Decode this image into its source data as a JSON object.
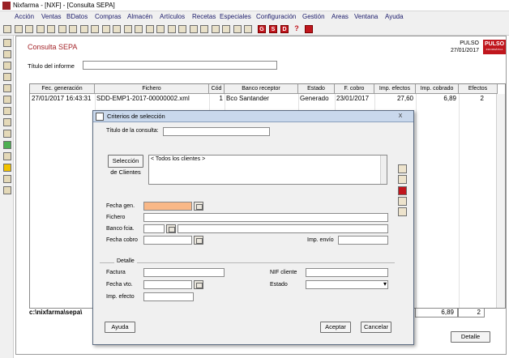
{
  "window": {
    "title": "Nixfarma - [NXF] - [Consulta SEPA]"
  },
  "menu": [
    "Acción",
    "Ventas",
    "BDatos",
    "Compras",
    "Almacén",
    "Artículos",
    "Recetas",
    "Especiales",
    "Configuración",
    "Gestión",
    "Areas",
    "Ventana",
    "Ayuda"
  ],
  "toolbar_icons": [
    "dock-icon",
    "cut-icon",
    "copy-icon",
    "paste-icon",
    "save-icon",
    "print-icon",
    "filter-icon",
    "duplicate-icon",
    "clipboard-icon",
    "calendar-icon",
    "star-icon",
    "first-icon",
    "prev-icon",
    "next-icon",
    "last-icon",
    "printer-icon",
    "find-icon",
    "binoculars-icon",
    "tools-icon",
    "exit-icon",
    "grid-icon",
    "camera-icon",
    "notes-icon"
  ],
  "toolbar_letters": {
    "g": "G",
    "s": "S",
    "d": "D",
    "help": "?"
  },
  "sidebar_icons": [
    "sales-icon",
    "cash-icon",
    "user-icon",
    "cart-icon",
    "money-icon",
    "pencil-icon",
    "box-icon",
    "document-icon",
    "calculator-icon",
    "add-icon",
    "refresh-icon",
    "warning-icon",
    "chart-icon",
    "table-icon"
  ],
  "page": {
    "title": "Consulta SEPA",
    "user": "PULSO",
    "date": "27/01/2017",
    "logo_text": "PULSO",
    "logo_sub": "INFORMÁTICA",
    "titulo_label": "Título del informe",
    "titulo_value": ""
  },
  "grid": {
    "columns": [
      "Fec. generación",
      "Fichero",
      "Cód",
      "Banco receptor",
      "Estado",
      "F. cobro",
      "Imp. efectos",
      "Imp. cobrado",
      "Efectos"
    ],
    "rows": [
      [
        "27/01/2017 16:43:31",
        "SDD-EMP1-2017-00000002.xml",
        "1",
        "Bco Santander",
        "Generado",
        "23/01/2017",
        "27,60",
        "6,89",
        "2"
      ]
    ]
  },
  "footer": {
    "path": "c:\\nixfarma\\sepa\\",
    "total_cobrado": "6,89",
    "total_efectos": "2",
    "detalle_button": "Detalle"
  },
  "dialog": {
    "title": "Criterios de selección",
    "close": "X",
    "titulo_consulta_label": "Título de la consulta:",
    "titulo_consulta_value": "",
    "sel_clientes_button": "Selección de Clientes",
    "clientes_list": [
      "< Todos los clientes >"
    ],
    "fecha_gen_label": "Fecha gen.",
    "fichero_label": "Fichero",
    "banco_label": "Banco fcia.",
    "fecha_cobro_label": "Fecha cobro",
    "imp_envio_label": "Imp. envío",
    "detalle_group": "Detalle",
    "factura_label": "Factura",
    "nif_label": "NIF cliente",
    "fecha_vto_label": "Fecha vto.",
    "estado_label": "Estado",
    "imp_efecto_label": "Imp. efecto",
    "ayuda_button": "Ayuda",
    "aceptar_button": "Aceptar",
    "cancelar_button": "Cancelar"
  },
  "colors": {
    "accent": "#a5262b",
    "highlight": "#f9b887",
    "dialog_title": "#c9d8ec"
  }
}
